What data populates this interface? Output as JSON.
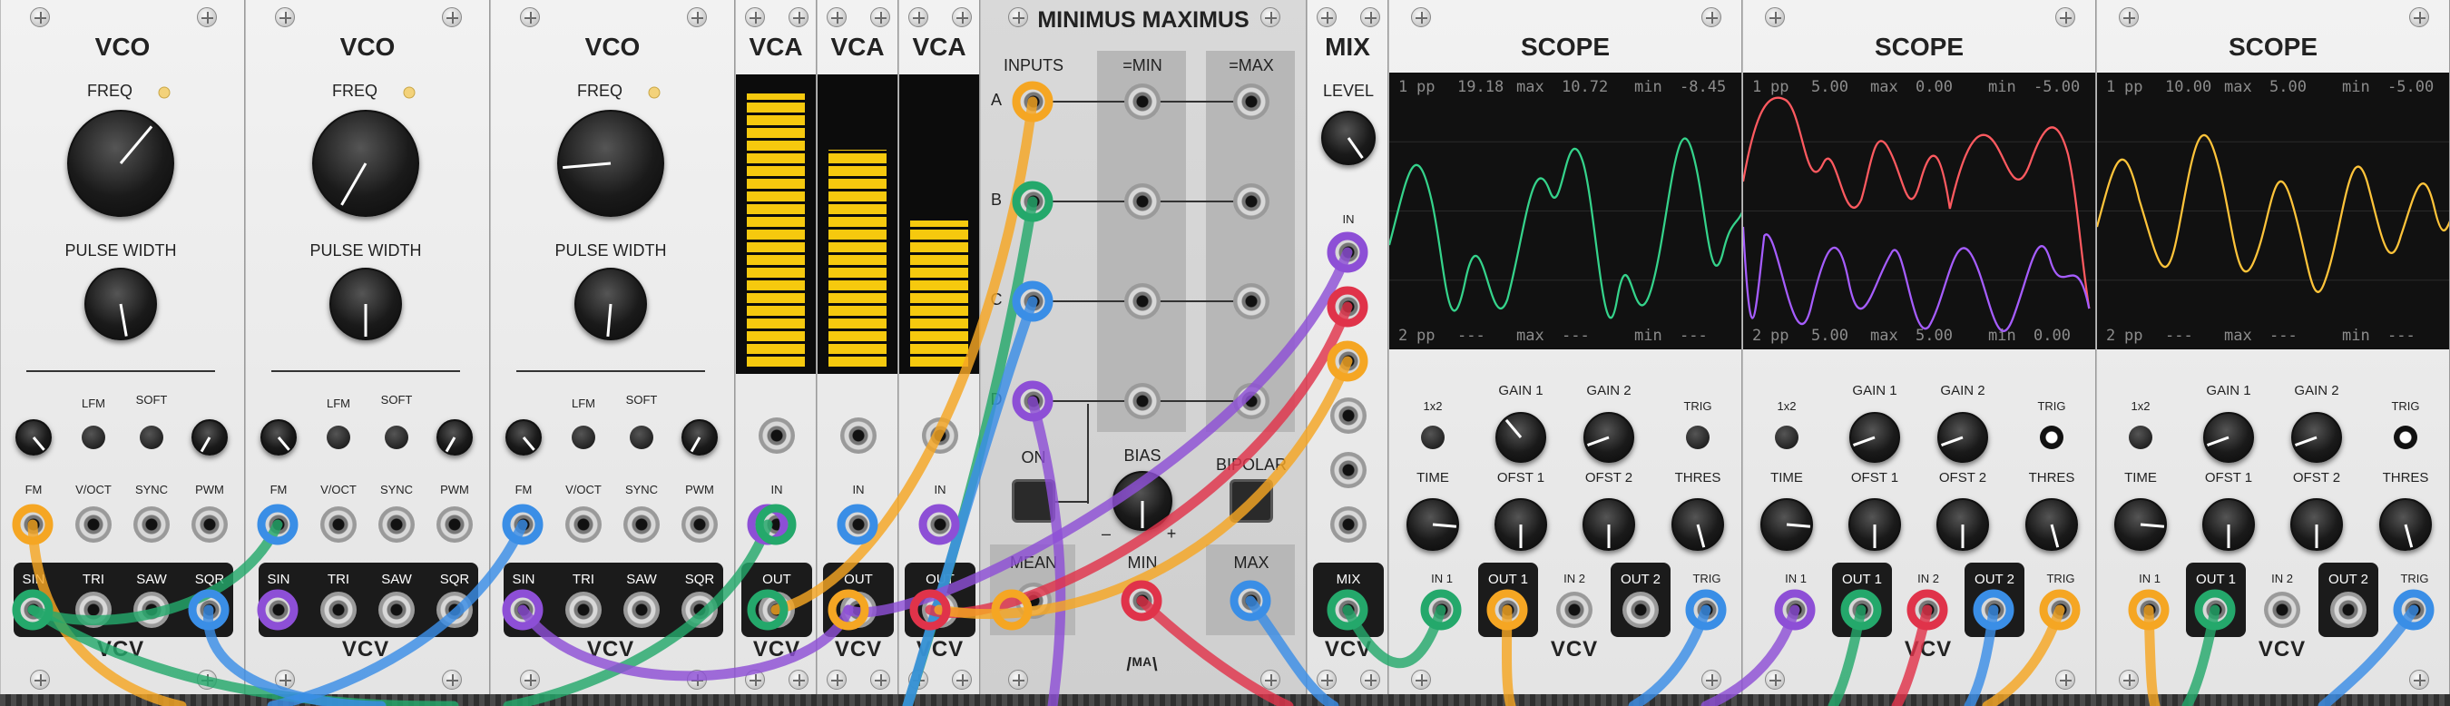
{
  "vco": {
    "title": "VCO",
    "freq": "FREQ",
    "pulse_width": "PULSE WIDTH",
    "lfm": "LFM",
    "soft": "SOFT",
    "fm": "FM",
    "voct": "V/OCT",
    "sync": "SYNC",
    "pwm": "PWM",
    "sin": "SIN",
    "tri": "TRI",
    "saw": "SAW",
    "sqr": "SQR",
    "logo": "VCV"
  },
  "vca": {
    "title": "VCA",
    "in": "IN",
    "out": "OUT",
    "logo": "VCV",
    "levels": [
      0.97,
      0.77,
      0.52
    ]
  },
  "mm": {
    "title": "MINIMUS MAXIMUS",
    "inputs": "INPUTS",
    "min_col": "=MIN",
    "max_col": "=MAX",
    "rows": [
      "A",
      "B",
      "C",
      "D"
    ],
    "on": "ON",
    "bias": "BIAS",
    "bipolar": "BIPOLAR",
    "minus": "–",
    "plus": "+",
    "mean": "MEAN",
    "min": "MIN",
    "max": "MAX",
    "logo": "/ᴹᴬ\\"
  },
  "mix": {
    "title": "MIX",
    "level": "LEVEL",
    "in": "IN",
    "mix": "MIX",
    "logo": "VCV"
  },
  "scope": {
    "title": "SCOPE",
    "x1x2": "1x2",
    "gain1": "GAIN 1",
    "gain2": "GAIN 2",
    "trig": "TRIG",
    "time": "TIME",
    "ofst1": "OFST 1",
    "ofst2": "OFST 2",
    "thres": "THRES",
    "in1": "IN 1",
    "out1": "OUT 1",
    "in2": "IN 2",
    "out2": "OUT 2",
    "logo": "VCV",
    "readouts": [
      {
        "ch1": "1",
        "pp1": "pp",
        "pp1v": "19.18",
        "max1": "max",
        "max1v": "10.72",
        "min1": "min",
        "min1v": "-8.45",
        "ch2": "2",
        "pp2": "pp",
        "pp2v": "---",
        "max2": "max",
        "max2v": "---",
        "min2": "min",
        "min2v": "---"
      },
      {
        "ch1": "1",
        "pp1": "pp",
        "pp1v": "5.00",
        "max1": "max",
        "max1v": "0.00",
        "min1": "min",
        "min1v": "-5.00",
        "ch2": "2",
        "pp2": "pp",
        "pp2v": "5.00",
        "max2": "max",
        "max2v": "5.00",
        "min2": "min",
        "min2v": "0.00"
      },
      {
        "ch1": "1",
        "pp1": "pp",
        "pp1v": "10.00",
        "max1": "max",
        "max1v": "5.00",
        "min1": "min",
        "min1v": "-5.00",
        "ch2": "2",
        "pp2": "pp",
        "pp2v": "---",
        "max2": "max",
        "max2v": "---",
        "min2": "min",
        "min2v": "---"
      }
    ]
  },
  "colors": {
    "orange": "#f5a623",
    "green": "#24a86b",
    "blue": "#3a8ee6",
    "purple": "#8d4fd6",
    "red": "#e0334a",
    "yellow": "#f6c90e",
    "scope_green": "#35d38b",
    "scope_red": "#ff5a60",
    "scope_purple": "#a65dff",
    "scope_yellow": "#ffc43a"
  }
}
